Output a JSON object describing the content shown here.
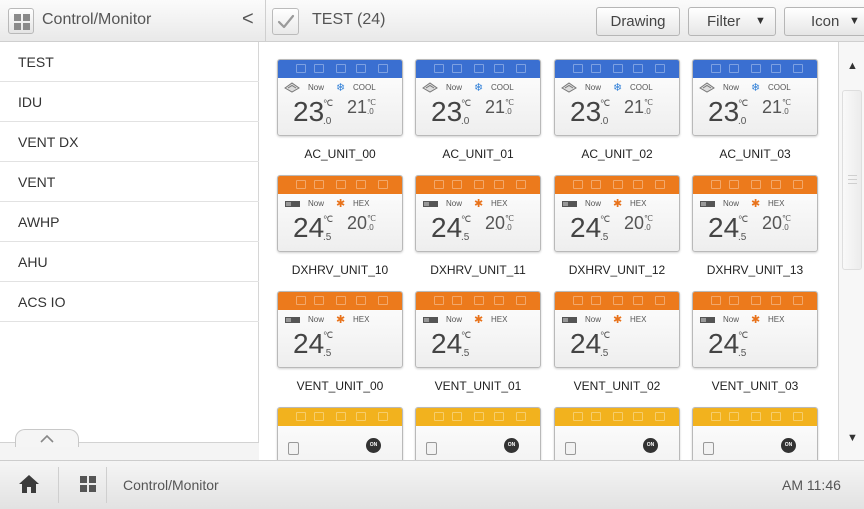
{
  "header": {
    "title": "Control/Monitor",
    "back_glyph": "<",
    "group_label": "TEST (24)",
    "drawing_label": "Drawing",
    "filter_label": "Filter",
    "icon_label": "Icon",
    "caret": "▼"
  },
  "sidebar": {
    "items": [
      {
        "label": "TEST",
        "active": true
      },
      {
        "label": "IDU",
        "active": false
      },
      {
        "label": "VENT DX",
        "active": false
      },
      {
        "label": "VENT",
        "active": false
      },
      {
        "label": "AWHP",
        "active": false
      },
      {
        "label": "AHU",
        "active": false
      },
      {
        "label": "ACS IO",
        "active": false
      }
    ],
    "collapse_glyph": "^"
  },
  "colors": {
    "accent": "#d21f44",
    "ac_header": "#3a6fd1",
    "vent_header": "#ec7a1c",
    "io_header": "#f2b21e",
    "cool_icon": "#2f7fd8",
    "heat_icon": "#e8731c"
  },
  "units": [
    {
      "name": "AC_UNIT_00",
      "kind": "ac",
      "now": "Now",
      "mode": "COOL",
      "mode_icon": "snowflake-icon",
      "temp": "23",
      "temp_dec": ".0",
      "set": "21",
      "set_dec": ".0"
    },
    {
      "name": "AC_UNIT_01",
      "kind": "ac",
      "now": "Now",
      "mode": "COOL",
      "mode_icon": "snowflake-icon",
      "temp": "23",
      "temp_dec": ".0",
      "set": "21",
      "set_dec": ".0"
    },
    {
      "name": "AC_UNIT_02",
      "kind": "ac",
      "now": "Now",
      "mode": "COOL",
      "mode_icon": "snowflake-icon",
      "temp": "23",
      "temp_dec": ".0",
      "set": "21",
      "set_dec": ".0"
    },
    {
      "name": "AC_UNIT_03",
      "kind": "ac",
      "now": "Now",
      "mode": "COOL",
      "mode_icon": "snowflake-icon",
      "temp": "23",
      "temp_dec": ".0",
      "set": "21",
      "set_dec": ".0"
    },
    {
      "name": "DXHRV_UNIT_10",
      "kind": "vent",
      "now": "Now",
      "mode": "HEX",
      "mode_icon": "heat-exchange-icon",
      "temp": "24",
      "temp_dec": ".5",
      "set": "20",
      "set_dec": ".0"
    },
    {
      "name": "DXHRV_UNIT_11",
      "kind": "vent",
      "now": "Now",
      "mode": "HEX",
      "mode_icon": "heat-exchange-icon",
      "temp": "24",
      "temp_dec": ".5",
      "set": "20",
      "set_dec": ".0"
    },
    {
      "name": "DXHRV_UNIT_12",
      "kind": "vent",
      "now": "Now",
      "mode": "HEX",
      "mode_icon": "heat-exchange-icon",
      "temp": "24",
      "temp_dec": ".5",
      "set": "20",
      "set_dec": ".0"
    },
    {
      "name": "DXHRV_UNIT_13",
      "kind": "vent",
      "now": "Now",
      "mode": "HEX",
      "mode_icon": "heat-exchange-icon",
      "temp": "24",
      "temp_dec": ".5",
      "set": "20",
      "set_dec": ".0"
    },
    {
      "name": "VENT_UNIT_00",
      "kind": "vent",
      "now": "Now",
      "mode": "HEX",
      "mode_icon": "heat-exchange-icon",
      "temp": "24",
      "temp_dec": ".5",
      "set": "",
      "set_dec": ""
    },
    {
      "name": "VENT_UNIT_01",
      "kind": "vent",
      "now": "Now",
      "mode": "HEX",
      "mode_icon": "heat-exchange-icon",
      "temp": "24",
      "temp_dec": ".5",
      "set": "",
      "set_dec": ""
    },
    {
      "name": "VENT_UNIT_02",
      "kind": "vent",
      "now": "Now",
      "mode": "HEX",
      "mode_icon": "heat-exchange-icon",
      "temp": "24",
      "temp_dec": ".5",
      "set": "",
      "set_dec": ""
    },
    {
      "name": "VENT_UNIT_03",
      "kind": "vent",
      "now": "Now",
      "mode": "HEX",
      "mode_icon": "heat-exchange-icon",
      "temp": "24",
      "temp_dec": ".5",
      "set": "",
      "set_dec": ""
    },
    {
      "name": "",
      "kind": "io",
      "on_label": "ON"
    },
    {
      "name": "",
      "kind": "io",
      "on_label": "ON"
    },
    {
      "name": "",
      "kind": "io",
      "on_label": "ON"
    },
    {
      "name": "",
      "kind": "io",
      "on_label": "ON"
    }
  ],
  "degree_unit": "℃",
  "footer": {
    "title": "Control/Monitor",
    "time": "AM 11:46"
  }
}
